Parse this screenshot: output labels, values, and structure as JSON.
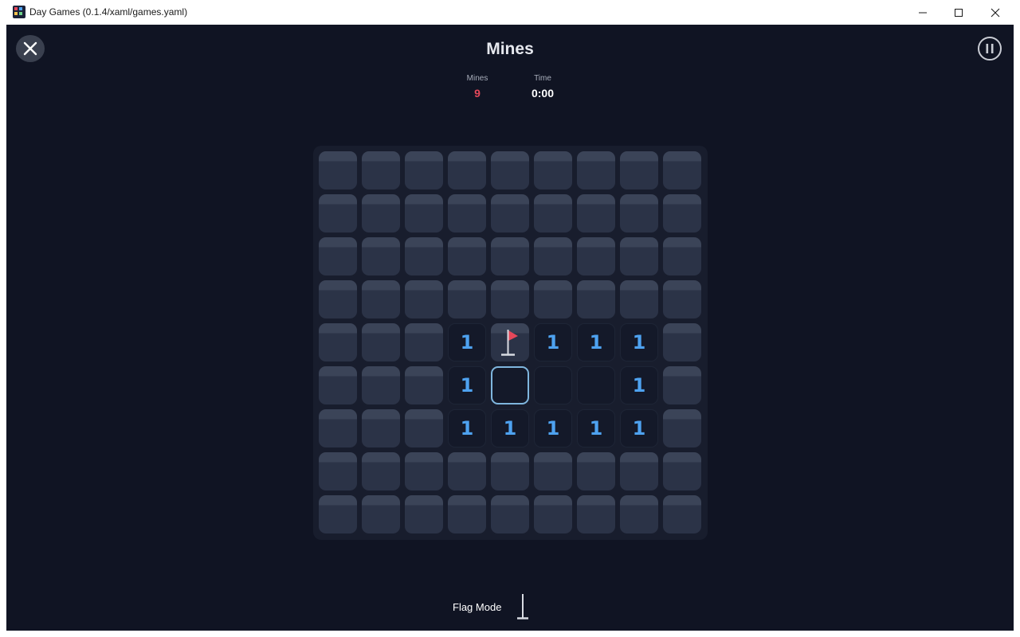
{
  "window": {
    "title": "Day Games (0.1.4/xaml/games.yaml)",
    "controls": [
      "minimize-icon",
      "maximize-icon",
      "close-icon"
    ]
  },
  "header": {
    "title": "Mines",
    "close_icon": "close-icon",
    "pause_icon": "pause-icon"
  },
  "stats": {
    "mines_label": "Mines",
    "mines_value": "9",
    "time_label": "Time",
    "time_value": "0:00"
  },
  "board": {
    "rows": 9,
    "cols": 9,
    "cells": [
      [
        "h",
        "h",
        "h",
        "h",
        "h",
        "h",
        "h",
        "h",
        "h"
      ],
      [
        "h",
        "h",
        "h",
        "h",
        "h",
        "h",
        "h",
        "h",
        "h"
      ],
      [
        "h",
        "h",
        "h",
        "h",
        "h",
        "h",
        "h",
        "h",
        "h"
      ],
      [
        "h",
        "h",
        "h",
        "h",
        "h",
        "h",
        "h",
        "h",
        "h"
      ],
      [
        "h",
        "h",
        "h",
        "1",
        "F",
        "1",
        "1",
        "1",
        "h"
      ],
      [
        "h",
        "h",
        "h",
        "1",
        "S",
        "0",
        "0",
        "1",
        "h"
      ],
      [
        "h",
        "h",
        "h",
        "1",
        "1",
        "1",
        "1",
        "1",
        "h"
      ],
      [
        "h",
        "h",
        "h",
        "h",
        "h",
        "h",
        "h",
        "h",
        "h"
      ],
      [
        "h",
        "h",
        "h",
        "h",
        "h",
        "h",
        "h",
        "h",
        "h"
      ]
    ],
    "legend": {
      "h": "hidden",
      "F": "flagged",
      "S": "selected-empty",
      "0": "revealed-empty"
    }
  },
  "footer": {
    "flag_mode_label": "Flag Mode",
    "flag_mode_icon": "flag-pole-icon"
  },
  "colors": {
    "background": "#101423",
    "board": "#181d2d",
    "hidden_cell_top": "#3b4458",
    "hidden_cell": "#2b3347",
    "number": "#4ea2f0",
    "mines_value": "#e5485a",
    "flag": "#e5485a",
    "selection": "#7fb6de"
  }
}
